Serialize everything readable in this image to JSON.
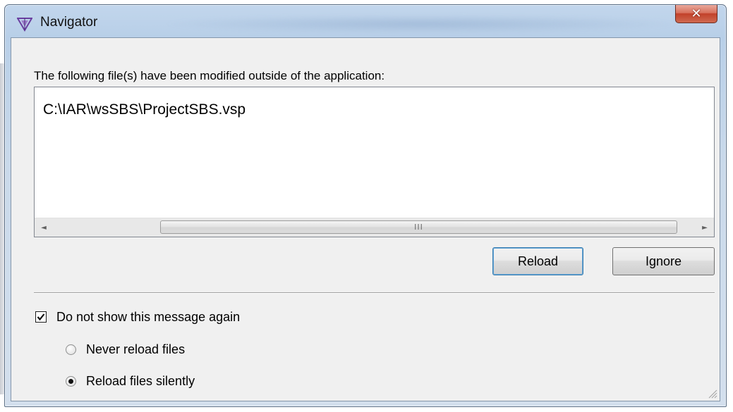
{
  "window": {
    "title": "Navigator",
    "close_glyph": "✕"
  },
  "dialog": {
    "message": "The following file(s) have been modified outside of the application:",
    "files": [
      "C:\\IAR\\wsSBS\\ProjectSBS.vsp"
    ],
    "scroll_left_glyph": "◄",
    "scroll_right_glyph": "►",
    "scroll_thumb_grip": "III",
    "buttons": {
      "reload": "Reload",
      "ignore": "Ignore"
    },
    "dont_show_again": {
      "label": "Do not show this message again",
      "checked": true
    },
    "radio_options": [
      {
        "label": "Never reload files",
        "selected": false
      },
      {
        "label": "Reload files silently",
        "selected": true
      }
    ]
  },
  "colors": {
    "frame_accent": "#b8cfe8",
    "close_button": "#c2412a",
    "client_bg": "#f0f0f0",
    "default_button_border": "#3c7fb1"
  },
  "icons": {
    "app": "navigator-triangle-icon",
    "close": "close-icon",
    "check": "checkmark-icon",
    "resize": "resize-grip-icon"
  }
}
